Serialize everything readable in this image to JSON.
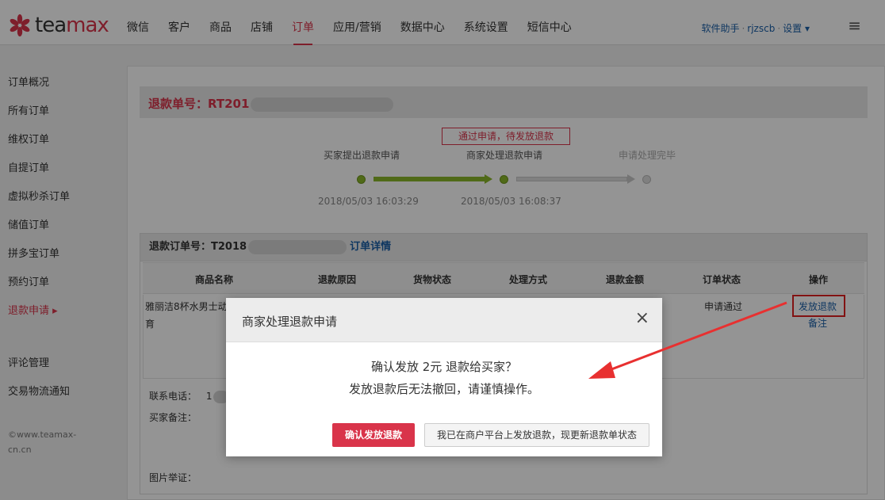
{
  "brand": {
    "logo_text_a": "tea",
    "logo_text_b": "max",
    "accent": "#d9344a"
  },
  "nav": {
    "items": [
      {
        "label": "微信"
      },
      {
        "label": "客户"
      },
      {
        "label": "商品"
      },
      {
        "label": "店铺"
      },
      {
        "label": "订单"
      },
      {
        "label": "应用/营销"
      },
      {
        "label": "数据中心"
      },
      {
        "label": "系统设置"
      },
      {
        "label": "短信中心"
      }
    ],
    "active": "订单"
  },
  "userbar": {
    "assistant": "软件助手",
    "sep1": "·",
    "user": "rjzscb",
    "sep2": "·",
    "settings": "设置 ▾"
  },
  "sidebar": {
    "items": [
      {
        "label": "订单概况"
      },
      {
        "label": "所有订单"
      },
      {
        "label": "维权订单"
      },
      {
        "label": "自提订单"
      },
      {
        "label": "虚拟秒杀订单"
      },
      {
        "label": "储值订单"
      },
      {
        "label": "拼多宝订单"
      },
      {
        "label": "预约订单"
      },
      {
        "label": "退款申请 ▸"
      },
      {
        "label": "评论管理"
      },
      {
        "label": "交易物流通知"
      }
    ],
    "copyright_line1": "©www.teamax-",
    "copyright_line2": "cn.cn"
  },
  "refund": {
    "number_label": "退款单号：RT201",
    "status_tag": "通过申请，待发放退款",
    "steps": [
      {
        "label": "买家提出退款申请",
        "time": "2018/05/03 16:03:29"
      },
      {
        "label": "商家处理退款申请",
        "time": "2018/05/03 16:08:37"
      },
      {
        "label": "申请处理完毕",
        "time": ""
      }
    ]
  },
  "order": {
    "number_label": "退款订单号：T2018",
    "detail_link": "订单详情",
    "columns": [
      "商品名称",
      "退款原因",
      "货物状态",
      "处理方式",
      "退款金额",
      "订单状态",
      "操作"
    ],
    "row": {
      "product_line1": "雅丽洁8杯水男士动",
      "product_line2": "育",
      "status": "申请通过",
      "op_refund": "发放退款",
      "op_note": "备注"
    },
    "phone_label": "联系电话：",
    "phone_value": "1",
    "buyer_note_label": "买家备注：",
    "image_label": "图片举证："
  },
  "modal": {
    "title": "商家处理退款申请",
    "close": "×",
    "line1": "确认发放 2元 退款给买家？",
    "line2": "发放退款后无法撤回，请谨慎操作。",
    "confirm_button": "确认发放退款",
    "alt_button": "我已在商户平台上发放退款，现更新退款单状态"
  }
}
